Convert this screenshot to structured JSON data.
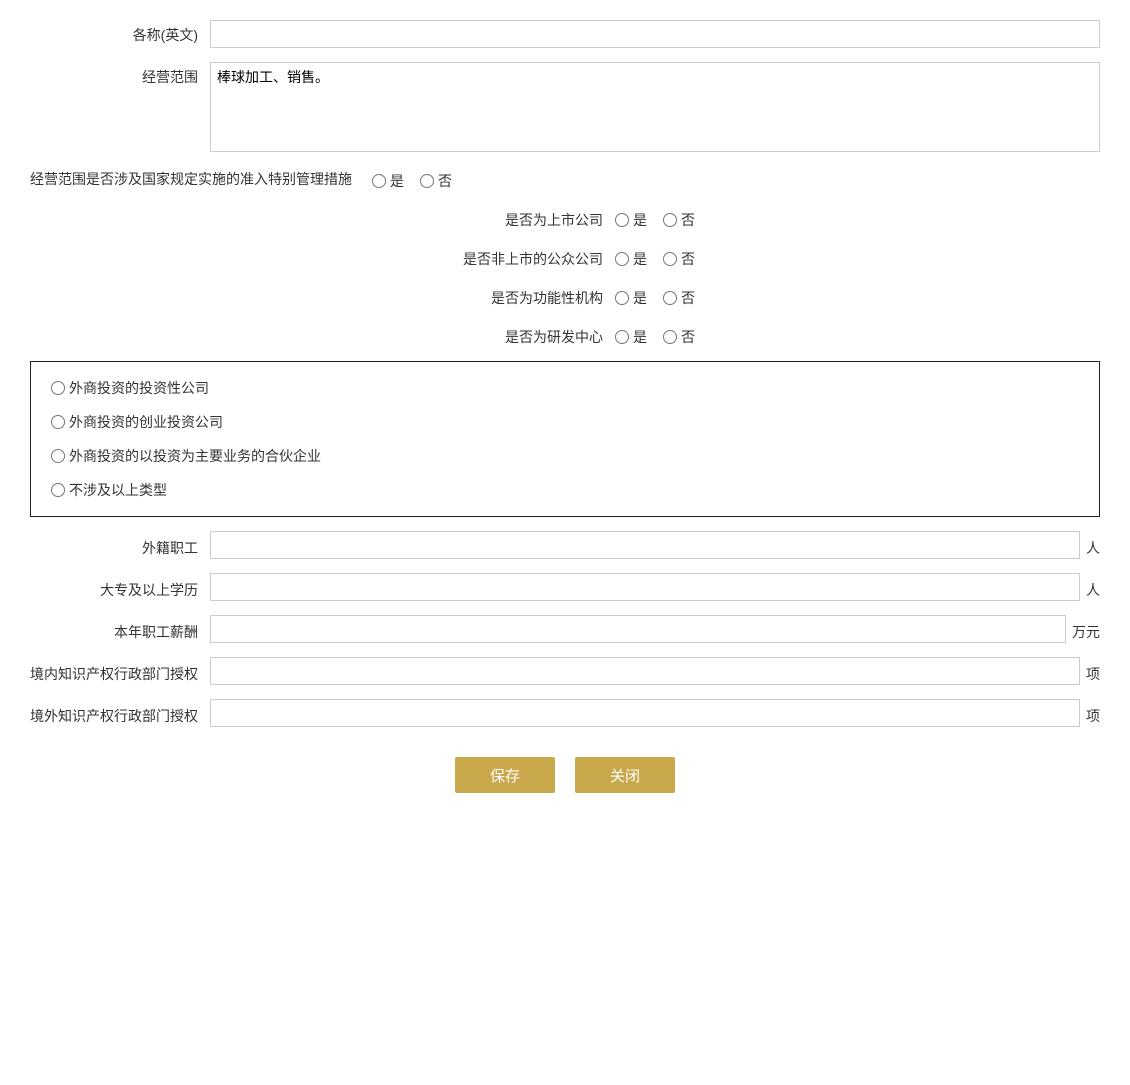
{
  "form": {
    "name_en_label": "各称(英文)",
    "name_en_value": "",
    "business_scope_label": "经营范围",
    "business_scope_value": "棒球加工、销售。",
    "special_mgmt_label": "经营范围是否涉及国家规定实施的准入特别管理措施",
    "yes_label": "是",
    "no_label": "否",
    "listed_company_label": "是否为上市公司",
    "non_listed_public_label": "是否非上市的公众公司",
    "functional_org_label": "是否为功能性机构",
    "rd_center_label": "是否为研发中心",
    "investment_types": [
      "外商投资的投资性公司",
      "外商投资的创业投资公司",
      "外商投资的以投资为主要业务的合伙企业",
      "不涉及以上类型"
    ],
    "foreign_staff_label": "外籍职工",
    "foreign_staff_unit": "人",
    "foreign_staff_value": "",
    "college_edu_label": "大专及以上学历",
    "college_edu_unit": "人",
    "college_edu_value": "",
    "annual_salary_label": "本年职工薪酬",
    "annual_salary_unit": "万元",
    "annual_salary_value": "",
    "domestic_ip_label": "境内知识产权行政部门授权",
    "domestic_ip_unit": "项",
    "domestic_ip_value": "",
    "foreign_ip_label": "境外知识产权行政部门授权",
    "foreign_ip_unit": "项",
    "foreign_ip_value": "",
    "save_btn": "保存",
    "close_btn": "关闭"
  }
}
